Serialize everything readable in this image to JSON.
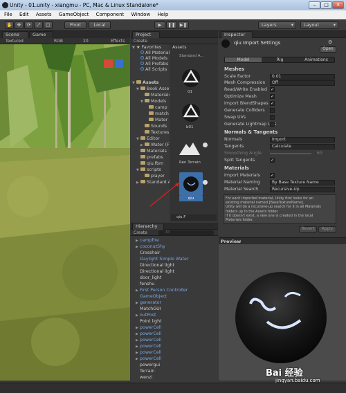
{
  "window": {
    "title": "Unity - 01.unity - xiangmu - PC, Mac & Linux Standalone*"
  },
  "menu": [
    "File",
    "Edit",
    "Assets",
    "GameObject",
    "Component",
    "Window",
    "Help"
  ],
  "toolbar": {
    "pivot": "Pivot",
    "local": "Local",
    "layers": "Layers",
    "layout": "Layout"
  },
  "scene": {
    "tab_scene": "Scene",
    "tab_game": "Game",
    "shading": "Textured",
    "mode": "RGB",
    "zoom": "20",
    "effects": "Effects"
  },
  "project": {
    "tab": "Project",
    "create": "Create",
    "favorites_label": "Favorites",
    "favorites": [
      "All Materials",
      "All Models",
      "All Prefabs",
      "All Scripts"
    ],
    "assets_label": "Assets",
    "tree": [
      "Book Assets",
      "Materials",
      "Models",
      "camp",
      "match",
      "Mater",
      "Sounds",
      "Textures",
      "Editor",
      "Water (F",
      "Materials",
      "prefabs",
      "qiu.fbm",
      "scripts",
      "player",
      "Standard A"
    ],
    "grid_header": "Assets",
    "grid_sub": "Standard A...",
    "items": [
      "01",
      "b01",
      "Ren Terrain",
      "qiu"
    ],
    "selected_footer": "qiu.F"
  },
  "hierarchy": {
    "tab": "Hierarchy",
    "create": "Create",
    "search_placeholder": "All",
    "items": [
      {
        "name": "campfire",
        "prefab": true,
        "arrow": true
      },
      {
        "name": "coconutShy",
        "prefab": true,
        "arrow": true
      },
      {
        "name": "Crosshair",
        "prefab": false,
        "arrow": false
      },
      {
        "name": "Daylight Simple Water",
        "prefab": true,
        "arrow": false
      },
      {
        "name": "Directional light",
        "prefab": false,
        "arrow": false
      },
      {
        "name": "Directional light",
        "prefab": false,
        "arrow": false
      },
      {
        "name": "door_light",
        "prefab": false,
        "arrow": false
      },
      {
        "name": "fenshu",
        "prefab": false,
        "arrow": false
      },
      {
        "name": "First Person Controller",
        "prefab": true,
        "arrow": true
      },
      {
        "name": "GameObject",
        "prefab": true,
        "arrow": false
      },
      {
        "name": "generator",
        "prefab": true,
        "arrow": true
      },
      {
        "name": "MatchGUI",
        "prefab": false,
        "arrow": false
      },
      {
        "name": "outPost",
        "prefab": true,
        "arrow": true
      },
      {
        "name": "Point light",
        "prefab": false,
        "arrow": false
      },
      {
        "name": "powerCell",
        "prefab": true,
        "arrow": true
      },
      {
        "name": "powerCell",
        "prefab": true,
        "arrow": true
      },
      {
        "name": "powerCell",
        "prefab": true,
        "arrow": true
      },
      {
        "name": "powerCell",
        "prefab": true,
        "arrow": true
      },
      {
        "name": "powerCell",
        "prefab": true,
        "arrow": true
      },
      {
        "name": "powerCell",
        "prefab": true,
        "arrow": true
      },
      {
        "name": "powergui",
        "prefab": false,
        "arrow": false
      },
      {
        "name": "Terrain",
        "prefab": false,
        "arrow": false
      },
      {
        "name": "wenzi",
        "prefab": false,
        "arrow": false
      }
    ]
  },
  "inspector": {
    "tab": "Inspector",
    "title": "qiu Import Settings",
    "open": "Open",
    "tabs": [
      "Model",
      "Rig",
      "Animations"
    ],
    "meshes_title": "Meshes",
    "scale_factor_label": "Scale Factor",
    "scale_factor": "0.01",
    "mesh_compression_label": "Mesh Compression",
    "mesh_compression": "Off",
    "read_write_label": "Read/Write Enabled",
    "optimize_mesh_label": "Optimize Mesh",
    "import_blendshapes_label": "Import BlendShapes",
    "generate_colliders_label": "Generate Colliders",
    "swap_uvs_label": "Swap UVs",
    "generate_lightmap_label": "Generate Lightmap UVs",
    "normals_title": "Normals & Tangents",
    "normals_label": "Normals",
    "normals": "Import",
    "tangents_label": "Tangents",
    "tangents": "Calculate",
    "smoothing_label": "Smoothing Angle",
    "smoothing": "60",
    "split_tangents_label": "Split Tangents",
    "materials_title": "Materials",
    "import_materials_label": "Import Materials",
    "material_naming_label": "Material Naming",
    "material_naming": "By Base Texture Name",
    "material_search_label": "Material Search",
    "material_search": "Recursive-Up",
    "help_text": [
      "For each imported material, Unity first looks for an",
      "existing material named [BaseTextureName].",
      "Unity will do a recursive-up search for it in all Materials",
      "folders up to the Assets folder.",
      "If it doesn't exist, a new one is created in the local",
      "Materials folder."
    ],
    "revert": "Revert",
    "apply": "Apply",
    "preview_title": "Preview"
  },
  "watermark": {
    "brand": "Bai 经验",
    "url": "jingyan.baidu.com"
  }
}
